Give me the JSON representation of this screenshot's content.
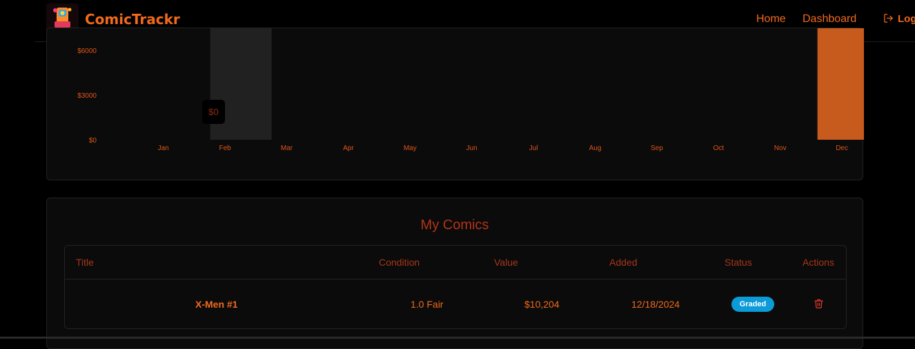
{
  "nav": {
    "brand": "ComicTrackr",
    "home": "Home",
    "dashboard": "Dashboard",
    "logout": "Log"
  },
  "chart_data": {
    "type": "bar",
    "categories": [
      "Jan",
      "Feb",
      "Mar",
      "Apr",
      "May",
      "Jun",
      "Jul",
      "Aug",
      "Sep",
      "Oct",
      "Nov",
      "Dec"
    ],
    "values": [
      0,
      0,
      0,
      0,
      0,
      0,
      0,
      0,
      0,
      0,
      0,
      10204
    ],
    "y_ticks": [
      "$0",
      "$3000",
      "$6000"
    ],
    "tooltip": {
      "category": "Feb",
      "text": "$0"
    },
    "bar_color": "#c75a1d",
    "hover_color": "#212121"
  },
  "comics": {
    "title": "My Comics",
    "columns": [
      "Title",
      "Condition",
      "Value",
      "Added",
      "Status",
      "Actions"
    ],
    "rows": [
      {
        "title": "X-Men #1",
        "condition": "1.0 Fair",
        "value": "$10,204",
        "added": "12/18/2024",
        "status": "Graded"
      }
    ]
  },
  "colors": {
    "accent": "#f26a1b",
    "dim_accent": "#a8361a",
    "badge": "#0b9bd8"
  }
}
